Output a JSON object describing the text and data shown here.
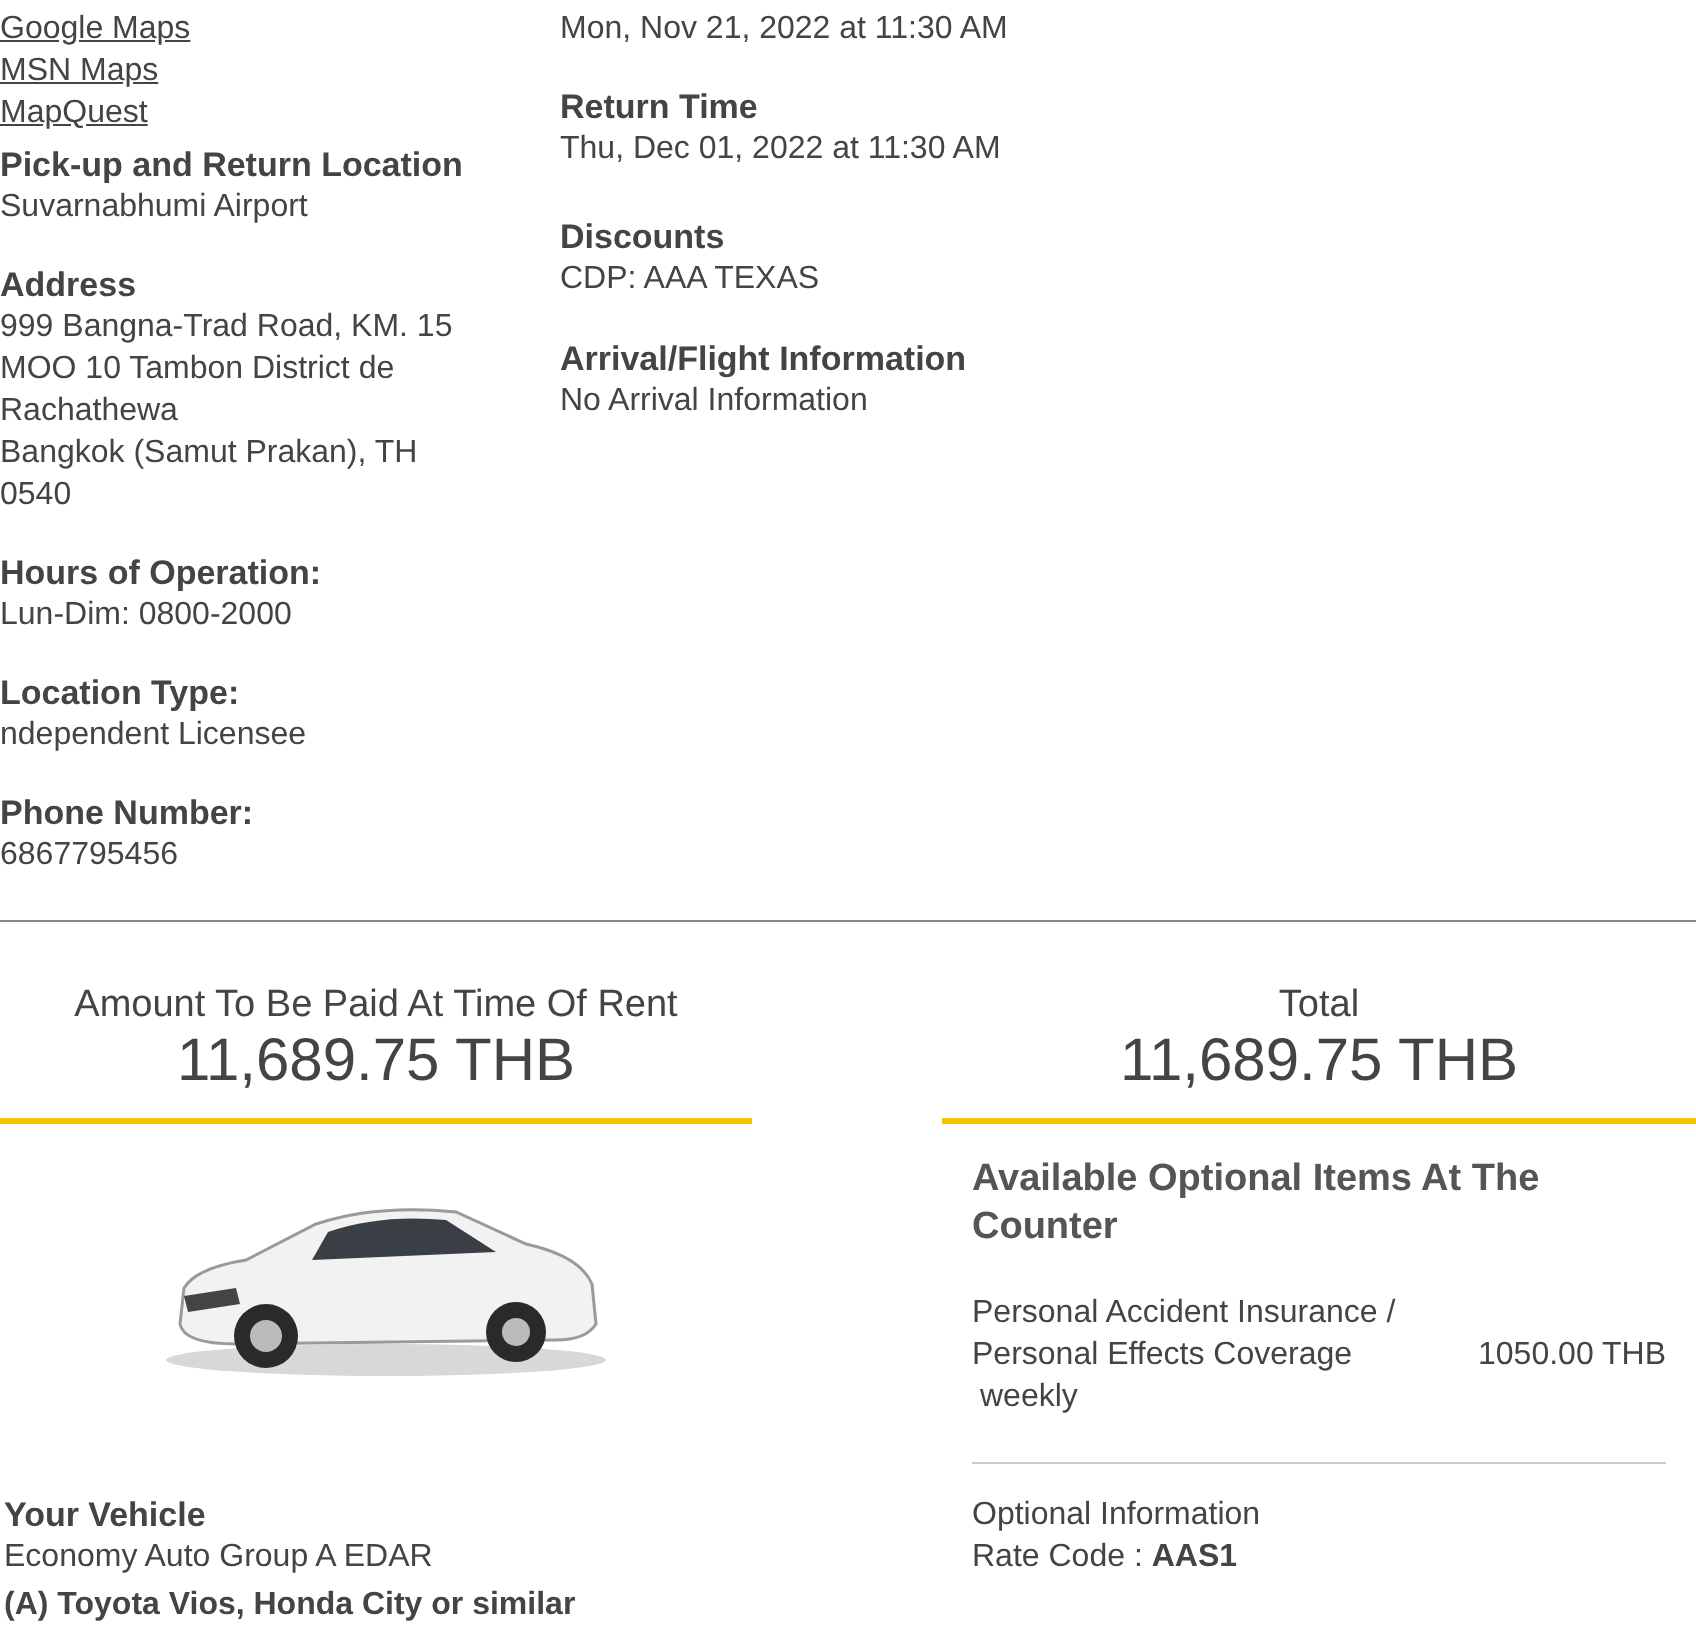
{
  "location": {
    "links": [
      "Google Maps",
      "MSN Maps",
      "MapQuest"
    ],
    "fields": [
      {
        "label": "Pick-up and Return Location",
        "lines": [
          "Suvarnabhumi Airport"
        ]
      },
      {
        "label": "Address",
        "lines": [
          "999 Bangna-Trad Road, KM. 15",
          "MOO 10 Tambon District de",
          "Rachathewa",
          "Bangkok (Samut Prakan), TH",
          "0540"
        ]
      },
      {
        "label": "Hours of Operation:",
        "lines": [
          "Lun-Dim: 0800-2000"
        ]
      },
      {
        "label": "Location Type:",
        "lines": [
          "ndependent Licensee"
        ]
      },
      {
        "label": "Phone Number:",
        "lines": [
          "6867795456"
        ]
      }
    ]
  },
  "trip": {
    "pickup_value": "Mon, Nov 21, 2022 at 11:30 AM",
    "fields": [
      {
        "label": "Return Time",
        "value": "Thu, Dec 01, 2022 at 11:30 AM"
      },
      {
        "label": "Discounts",
        "value": "CDP: AAA TEXAS"
      },
      {
        "label": "Arrival/Flight Information",
        "value": "No Arrival Information"
      }
    ]
  },
  "amount_due": {
    "label": "Amount To Be Paid At Time Of Rent",
    "value": "11,689.75 THB"
  },
  "total": {
    "label": "Total",
    "value": "11,689.75 THB"
  },
  "vehicle": {
    "label": "Your Vehicle",
    "group": "Economy Auto Group A EDAR",
    "models": "(A) Toyota Vios, Honda City or similar"
  },
  "optional_items": {
    "title": "Available Optional Items At The Counter",
    "items": [
      {
        "name": "Personal Accident Insurance / Personal Effects Coverage",
        "price": "1050.00 THB",
        "period": "weekly"
      }
    ],
    "info_label": "Optional Information",
    "rate_code": "Rate Code : **AAS1**"
  }
}
